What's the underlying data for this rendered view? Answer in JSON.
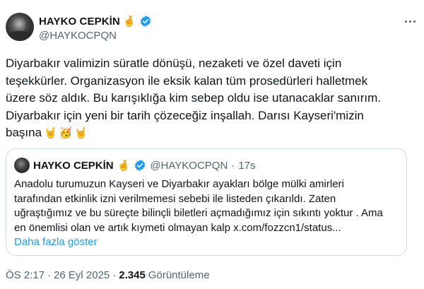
{
  "author": {
    "name": "HAYKO CEPKİN",
    "handle": "@HAYKOCPQN",
    "name_emoji": "🤞",
    "verified_icon": "verified-badge-icon",
    "verified_color": "#1d9bf0"
  },
  "tweet": {
    "lines": [
      "Diyarbakır valimizin süratle dönüşü, nezaketi ve özel daveti için",
      "teşekkürler. Organizasyon ile eksik kalan tüm prosedürleri halletmek",
      "üzere söz aldık. Bu karışıklığa kim sebep oldu ise utanacaklar sanırım.",
      "Diyarbakır için yeni bir tarih çözeceğiz inşallah. Darısı Kayseri'mizin",
      "başına"
    ],
    "emojis": [
      "🤘",
      "🥳",
      "🤘"
    ]
  },
  "quote": {
    "name": "HAYKO CEPKİN",
    "name_emoji": "🤞",
    "handle": "@HAYKOCPQN",
    "separator": "·",
    "time": "17s",
    "lines": [
      "Anadolu turumuzun Kayseri ve Diyarbakır ayakları bölge mülki amirleri",
      "tarafından etkinlik izni verilmemesi sebebi ile listeden çıkarıldı. Zaten",
      "uğraştığımız ve bu süreçte bilinçli biletleri açmadığımız için sıkıntı yoktur . Ama",
      "en önemlisi olan ve artık kıymeti olmayan kalp x.com/fozzcn1/status..."
    ],
    "show_more": "Daha fazla göster"
  },
  "meta": {
    "time": "ÖS 2:17",
    "separator": "·",
    "date": "26 Eyl 2025",
    "views_count": "2.345",
    "views_label": "Görüntüleme"
  },
  "colors": {
    "accent": "#1d9bf0",
    "secondary_text": "#536471",
    "border": "#cfd9de"
  }
}
